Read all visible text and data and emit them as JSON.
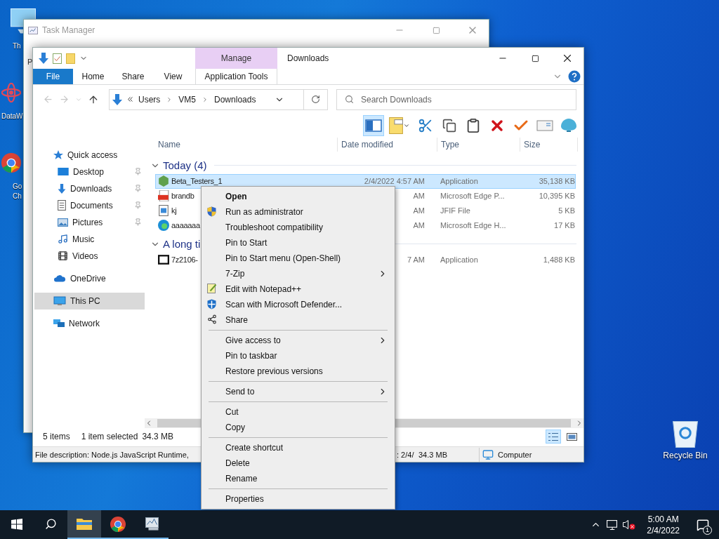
{
  "desktop": {
    "icons": [
      {
        "kind": "pc",
        "lines": [
          "Th"
        ]
      },
      {
        "kind": "app",
        "lines": [
          "DataW"
        ]
      },
      {
        "kind": "chrome",
        "lines": [
          "Go",
          "Ch"
        ]
      }
    ],
    "recycle_bin": {
      "label": "Recycle Bin"
    }
  },
  "task_manager": {
    "title": "Task Manager",
    "tab_stub": "P"
  },
  "explorer": {
    "title": "Downloads",
    "tabs": [
      {
        "label": "File",
        "kind": "file"
      },
      {
        "label": "Home",
        "kind": "tab"
      },
      {
        "label": "Share",
        "kind": "tab"
      },
      {
        "label": "View",
        "kind": "tab"
      }
    ],
    "contextual": {
      "group": "Manage",
      "tab": "Application Tools"
    },
    "address": {
      "crumbs": [
        "Users",
        "VM5",
        "Downloads"
      ]
    },
    "search": {
      "placeholder": "Search Downloads"
    },
    "toolbar": [
      {
        "kind": "pane",
        "pressed": true
      },
      {
        "kind": "layout",
        "pressed": false
      },
      {
        "kind": "cut",
        "pressed": false
      },
      {
        "kind": "copy",
        "pressed": false
      },
      {
        "kind": "paste",
        "pressed": false
      },
      {
        "kind": "delete",
        "pressed": false
      },
      {
        "kind": "check",
        "pressed": false
      },
      {
        "kind": "rename",
        "pressed": false
      },
      {
        "kind": "shell",
        "pressed": false
      }
    ],
    "nav": [
      {
        "label": "Quick access",
        "kind": "star",
        "selected": false,
        "children": [
          {
            "label": "Desktop",
            "kind": "desktop",
            "pinned": true,
            "selected": false
          },
          {
            "label": "Downloads",
            "kind": "download",
            "pinned": true,
            "selected": false
          },
          {
            "label": "Documents",
            "kind": "document",
            "pinned": true,
            "selected": false
          },
          {
            "label": "Pictures",
            "kind": "picture",
            "pinned": true,
            "selected": false
          },
          {
            "label": "Music",
            "kind": "music",
            "pinned": false,
            "selected": false
          },
          {
            "label": "Videos",
            "kind": "video",
            "pinned": false,
            "selected": false
          }
        ]
      },
      {
        "label": "OneDrive",
        "kind": "cloud",
        "selected": false
      },
      {
        "label": "This PC",
        "kind": "pc",
        "selected": true
      },
      {
        "label": "Network",
        "kind": "network",
        "selected": false
      }
    ],
    "columns": [
      "Name",
      "Date modified",
      "Type",
      "Size"
    ],
    "groups": [
      {
        "label": "Today (4)",
        "rows": [
          {
            "name": "Beta_Testers_1",
            "kind": "node",
            "date": "2/4/2022 4:57 AM",
            "type": "Application",
            "size": "35,138 KB",
            "selected": true
          },
          {
            "name": "brandb",
            "kind": "pdf",
            "date": "AM",
            "type": "Microsoft Edge P...",
            "size": "10,395 KB",
            "selected": false
          },
          {
            "name": "kj",
            "kind": "image",
            "date": "AM",
            "type": "JFIF File",
            "size": "5 KB",
            "selected": false
          },
          {
            "name": "aaaaaaa",
            "kind": "edge",
            "date": "AM",
            "type": "Microsoft Edge H...",
            "size": "17 KB",
            "selected": false
          }
        ]
      },
      {
        "label": "A long ti",
        "rows": [
          {
            "name": "7z2106-",
            "kind": "archive",
            "date": "7 AM",
            "type": "Application",
            "size": "1,488 KB",
            "selected": false
          }
        ]
      }
    ],
    "status": {
      "items": "5 items",
      "selected": "1 item selected",
      "size": "34.3 MB"
    },
    "details": {
      "description": "File description: Node.js JavaScript Runtime,",
      "date": ": 2/4/",
      "size": "34.3 MB",
      "location": "Computer"
    }
  },
  "context_menu": [
    {
      "kind": "plain",
      "label": "Open",
      "bold": true
    },
    {
      "kind": "admin",
      "label": "Run as administrator"
    },
    {
      "kind": "plain",
      "label": "Troubleshoot compatibility"
    },
    {
      "kind": "plain",
      "label": "Pin to Start"
    },
    {
      "kind": "plain",
      "label": "Pin to Start menu (Open-Shell)"
    },
    {
      "kind": "plain",
      "label": "7-Zip",
      "submenu": true
    },
    {
      "kind": "notepad",
      "label": "Edit with Notepad++"
    },
    {
      "kind": "defender",
      "label": "Scan with Microsoft Defender..."
    },
    {
      "kind": "share",
      "label": "Share"
    },
    {
      "kind": "separator"
    },
    {
      "kind": "plain",
      "label": "Give access to",
      "submenu": true
    },
    {
      "kind": "plain",
      "label": "Pin to taskbar"
    },
    {
      "kind": "plain",
      "label": "Restore previous versions"
    },
    {
      "kind": "separator"
    },
    {
      "kind": "plain",
      "label": "Send to",
      "submenu": true
    },
    {
      "kind": "separator"
    },
    {
      "kind": "plain",
      "label": "Cut"
    },
    {
      "kind": "plain",
      "label": "Copy"
    },
    {
      "kind": "separator"
    },
    {
      "kind": "plain",
      "label": "Create shortcut"
    },
    {
      "kind": "plain",
      "label": "Delete"
    },
    {
      "kind": "plain",
      "label": "Rename"
    },
    {
      "kind": "separator"
    },
    {
      "kind": "plain",
      "label": "Properties"
    }
  ],
  "taskbar": {
    "apps": [
      {
        "kind": "explorer",
        "selected": true,
        "running": true
      },
      {
        "kind": "chrome",
        "selected": false,
        "running": true
      },
      {
        "kind": "taskmgr",
        "selected": false,
        "running": true
      }
    ],
    "time": "5:00 AM",
    "date": "2/4/2022",
    "notifications": "1"
  }
}
